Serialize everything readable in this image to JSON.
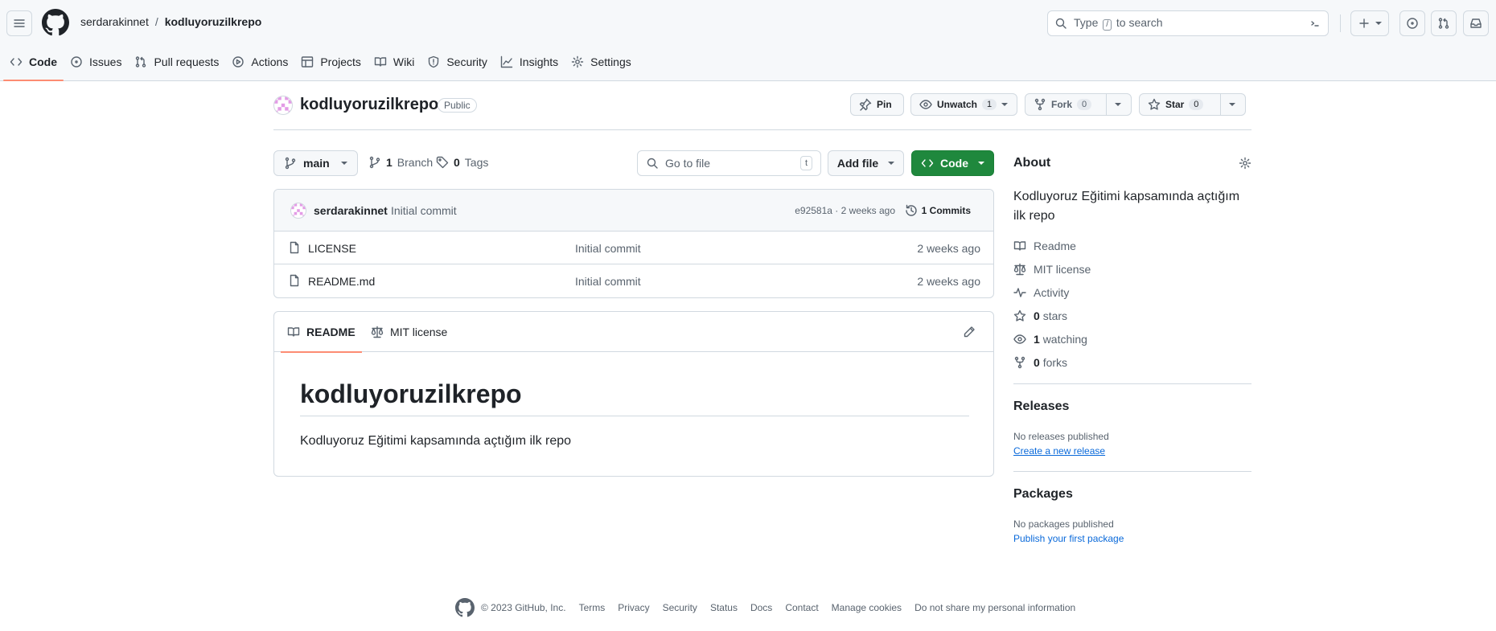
{
  "header": {
    "owner": "serdarakinnet",
    "separator": "/",
    "repo": "kodluyoruzilkrepo",
    "search": {
      "prefix": "Type",
      "slash": "/",
      "suffix": "to search"
    }
  },
  "nav": {
    "items": [
      {
        "label": "Code"
      },
      {
        "label": "Issues"
      },
      {
        "label": "Pull requests"
      },
      {
        "label": "Actions"
      },
      {
        "label": "Projects"
      },
      {
        "label": "Wiki"
      },
      {
        "label": "Security"
      },
      {
        "label": "Insights"
      },
      {
        "label": "Settings"
      }
    ]
  },
  "repo_header": {
    "name": "kodluyoruzilkrepo",
    "visibility": "Public",
    "pin_label": "Pin",
    "unwatch_label": "Unwatch",
    "watch_count": "1",
    "fork_label": "Fork",
    "fork_count": "0",
    "star_label": "Star",
    "star_count": "0"
  },
  "toolbar": {
    "branch": "main",
    "branch_count": "1",
    "branch_label": "Branch",
    "tag_count": "0",
    "tag_label": "Tags",
    "goto_placeholder": "Go to file",
    "goto_key": "t",
    "add_file": "Add file",
    "code": "Code"
  },
  "commit": {
    "author": "serdarakinnet",
    "message": "Initial commit",
    "meta": "e92581a · 2 weeks ago",
    "commits_label": "1 Commits"
  },
  "files": [
    {
      "name": "LICENSE",
      "message": "Initial commit",
      "date": "2 weeks ago"
    },
    {
      "name": "README.md",
      "message": "Initial commit",
      "date": "2 weeks ago"
    }
  ],
  "readme": {
    "tab_readme": "README",
    "tab_license": "MIT license",
    "heading": "kodluyoruzilkrepo",
    "body": "Kodluyoruz Eğitimi kapsamında açtığım ilk repo"
  },
  "about": {
    "title": "About",
    "description": "Kodluyoruz Eğitimi kapsamında açtığım ilk repo",
    "readme": "Readme",
    "license": "MIT license",
    "activity": "Activity",
    "stars_count": "0",
    "stars_label": "stars",
    "watching_count": "1",
    "watching_label": "watching",
    "forks_count": "0",
    "forks_label": "forks"
  },
  "releases": {
    "title": "Releases",
    "empty": "No releases published",
    "create_link": "Create a new release"
  },
  "packages": {
    "title": "Packages",
    "empty": "No packages published",
    "publish_link": "Publish your first package"
  },
  "footer": {
    "copyright": "© 2023 GitHub, Inc.",
    "links": [
      "Terms",
      "Privacy",
      "Security",
      "Status",
      "Docs",
      "Contact",
      "Manage cookies",
      "Do not share my personal information"
    ]
  },
  "colors": {
    "accent_underline": "#fd8c73",
    "code_button": "#1f883d",
    "link": "#0969da",
    "border": "#d1d9e0"
  }
}
